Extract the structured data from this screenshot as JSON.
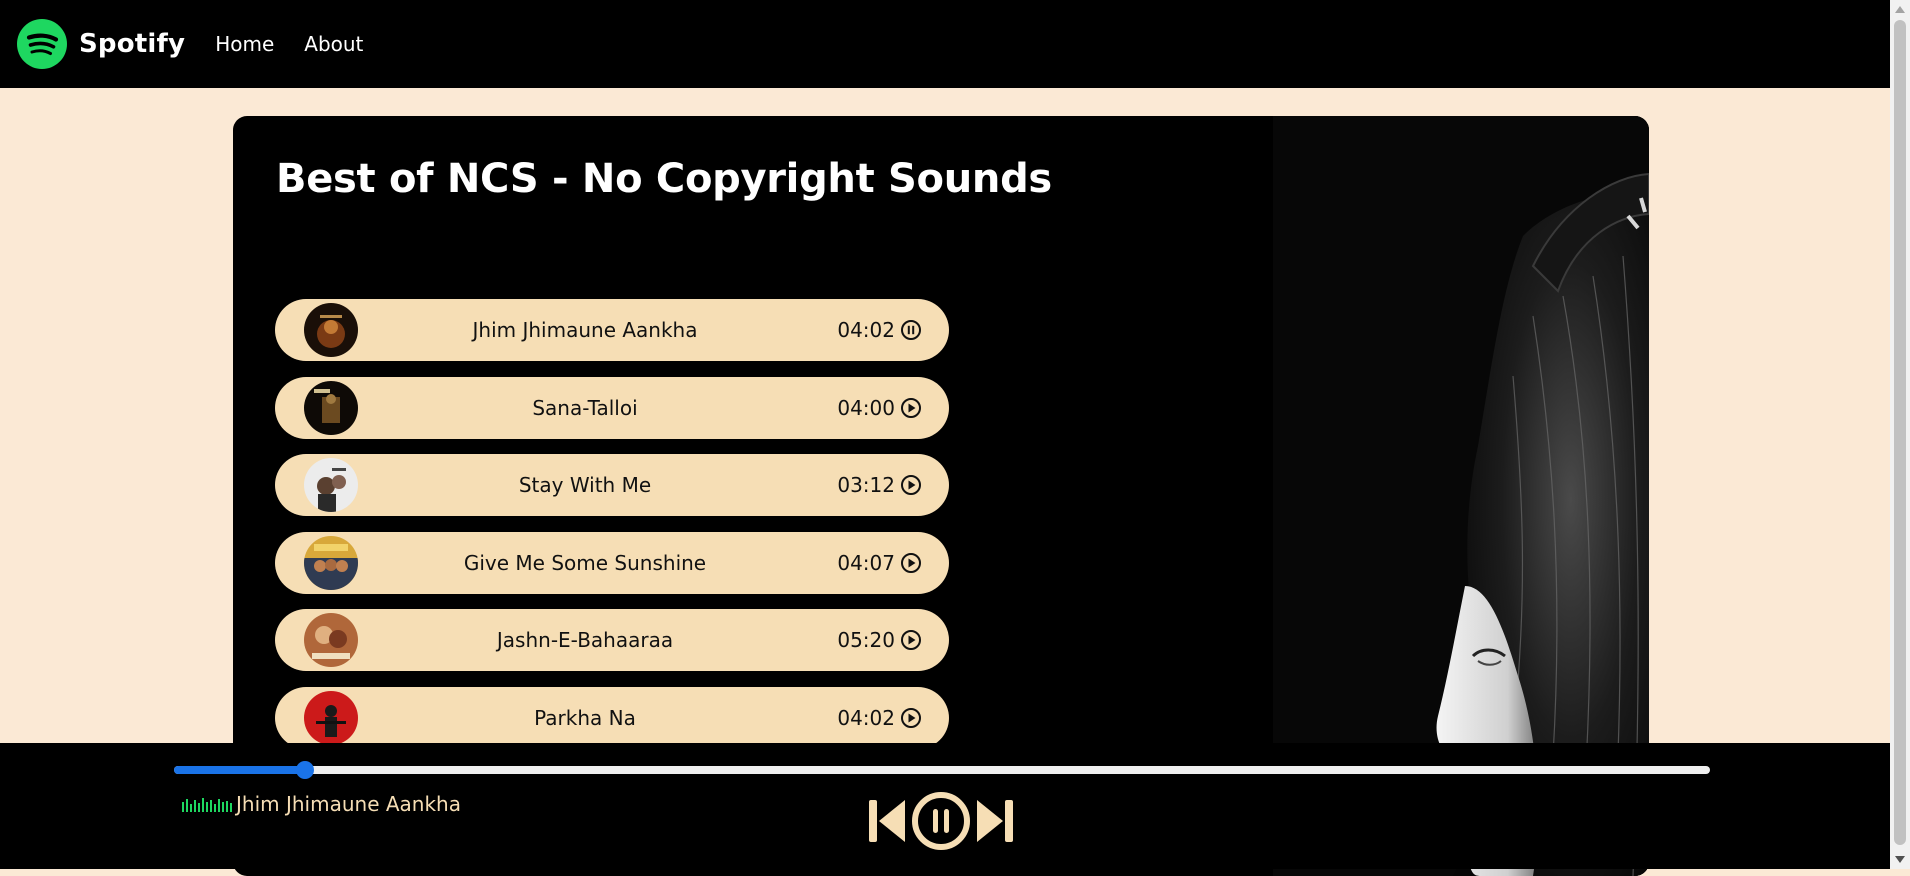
{
  "nav": {
    "brand": "Spotify",
    "links": [
      "Home",
      "About"
    ]
  },
  "playlist": {
    "title": "Best of NCS - No Copyright Sounds",
    "songs": [
      {
        "name": "Jhim Jhimaune Aankha",
        "duration": "04:02",
        "state": "pause-icon",
        "cover_color": "#3a2412"
      },
      {
        "name": "Sana-Talloi",
        "duration": "04:00",
        "state": "play-icon",
        "cover_color": "#2a1c10"
      },
      {
        "name": "Stay With Me",
        "duration": "03:12",
        "state": "play-icon",
        "cover_color": "#e8e8e8"
      },
      {
        "name": "Give Me Some Sunshine",
        "duration": "04:07",
        "state": "play-icon",
        "cover_color": "#d8a83a"
      },
      {
        "name": "Jashn-E-Bahaaraa",
        "duration": "05:20",
        "state": "play-icon",
        "cover_color": "#b0673a"
      },
      {
        "name": "Parkha Na",
        "duration": "04:02",
        "state": "play-icon",
        "cover_color": "#cc1a1a"
      }
    ]
  },
  "player": {
    "current_song": "Jhim Jhimaune Aankha",
    "progress_fraction": 0.085,
    "controls": [
      "previous-icon",
      "pause-icon",
      "next-icon"
    ]
  },
  "colors": {
    "accent": "#1a73e8",
    "brand_green": "#1ed760",
    "song_bg": "#f6deb5",
    "page_bg": "#fbe9d5"
  }
}
